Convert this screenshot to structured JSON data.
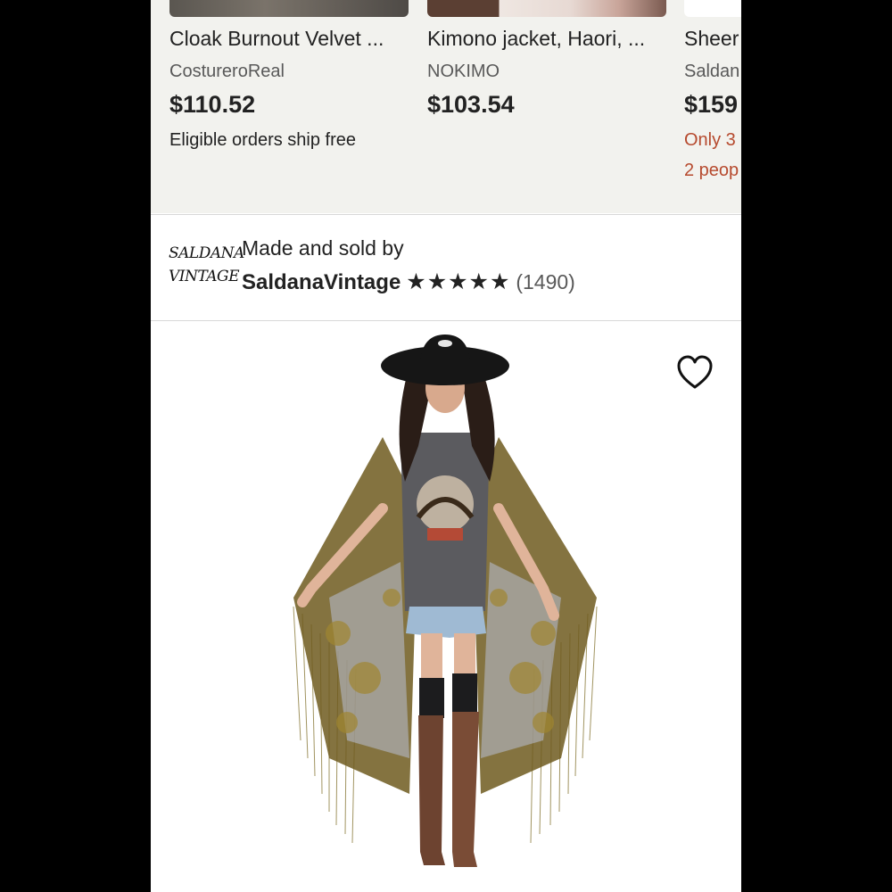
{
  "recommendations": [
    {
      "title": "Cloak Burnout Velvet ...",
      "shop": "CostureroReal",
      "price": "$110.52",
      "note": "Eligible orders ship free"
    },
    {
      "title": "Kimono jacket, Haori, ...",
      "shop": "NOKIMO",
      "price": "$103.54"
    },
    {
      "title": "Sheer",
      "shop": "Saldan",
      "price": "$159",
      "urgency": [
        "Only 3",
        "2 peop"
      ]
    }
  ],
  "seller": {
    "logo_line1": "SALDANA",
    "logo_line2": "VINTAGE",
    "made_by": "Made and sold by",
    "name": "SaldanaVintage",
    "stars": "★★★★★",
    "reviews": "(1490)"
  },
  "product": {
    "favorite_icon": "heart-outline-icon",
    "image": "model-wearing-velvet-burnout-kimono"
  },
  "colors": {
    "background": "#f2f2ee",
    "text": "#222222",
    "muted": "#595959",
    "urgent": "#b64a2e"
  }
}
